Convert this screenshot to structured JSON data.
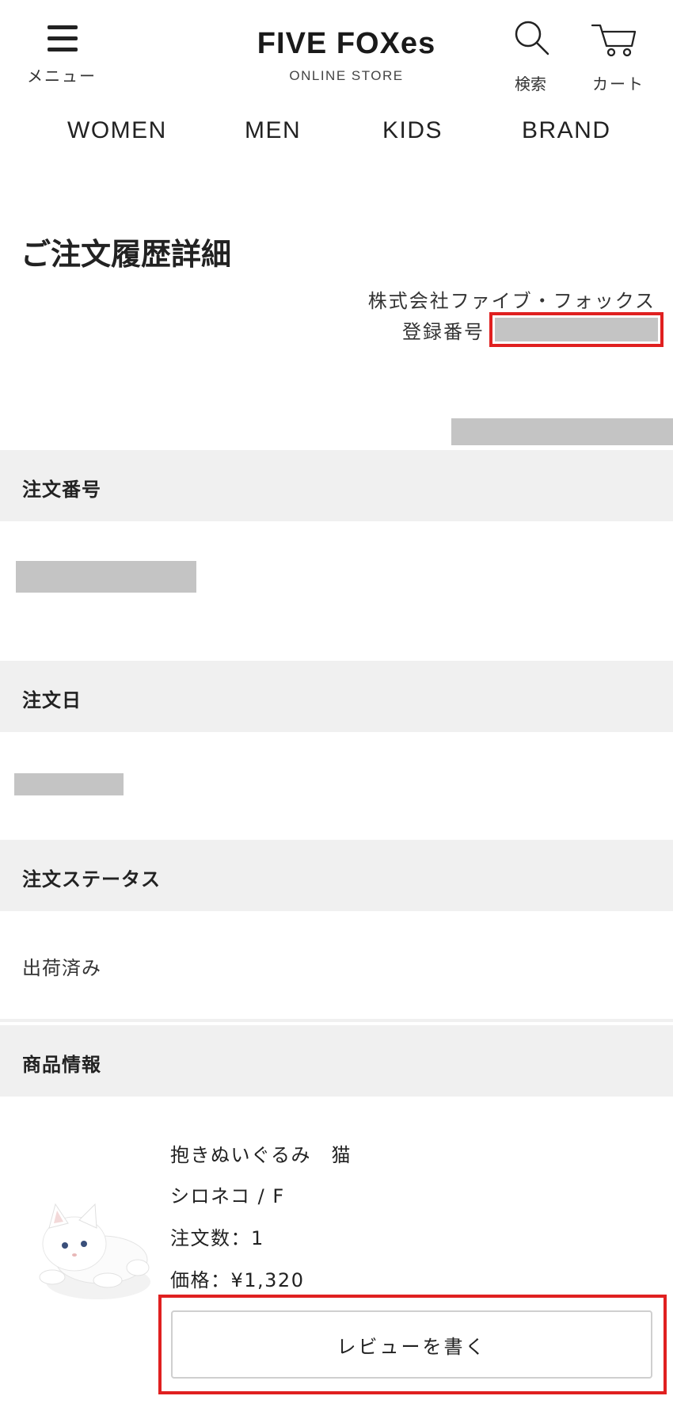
{
  "header": {
    "menu_label": "メニュー",
    "logo_main": "FIVE FOXes",
    "logo_sub": "ONLINE STORE",
    "search_label": "検索",
    "cart_label": "カート"
  },
  "nav": {
    "items": [
      "WOMEN",
      "MEN",
      "KIDS",
      "BRAND"
    ]
  },
  "page": {
    "title": "ご注文履歴詳細",
    "company": "株式会社ファイブ・フォックス",
    "registration_label": "登録番号"
  },
  "sections": {
    "order_number": "注文番号",
    "order_date": "注文日",
    "order_status": "注文ステータス",
    "status_value": "出荷済み",
    "product_info": "商品情報"
  },
  "product": {
    "name": "抱きぬいぐるみ　猫",
    "variant": "シロネコ / F",
    "quantity": "注文数：1",
    "price": "価格：¥1,320",
    "review_button": "レビューを書く"
  },
  "colors": {
    "accent_red": "#e02020",
    "section_bg": "#f0f0f0",
    "redaction": "#c4c4c4"
  }
}
